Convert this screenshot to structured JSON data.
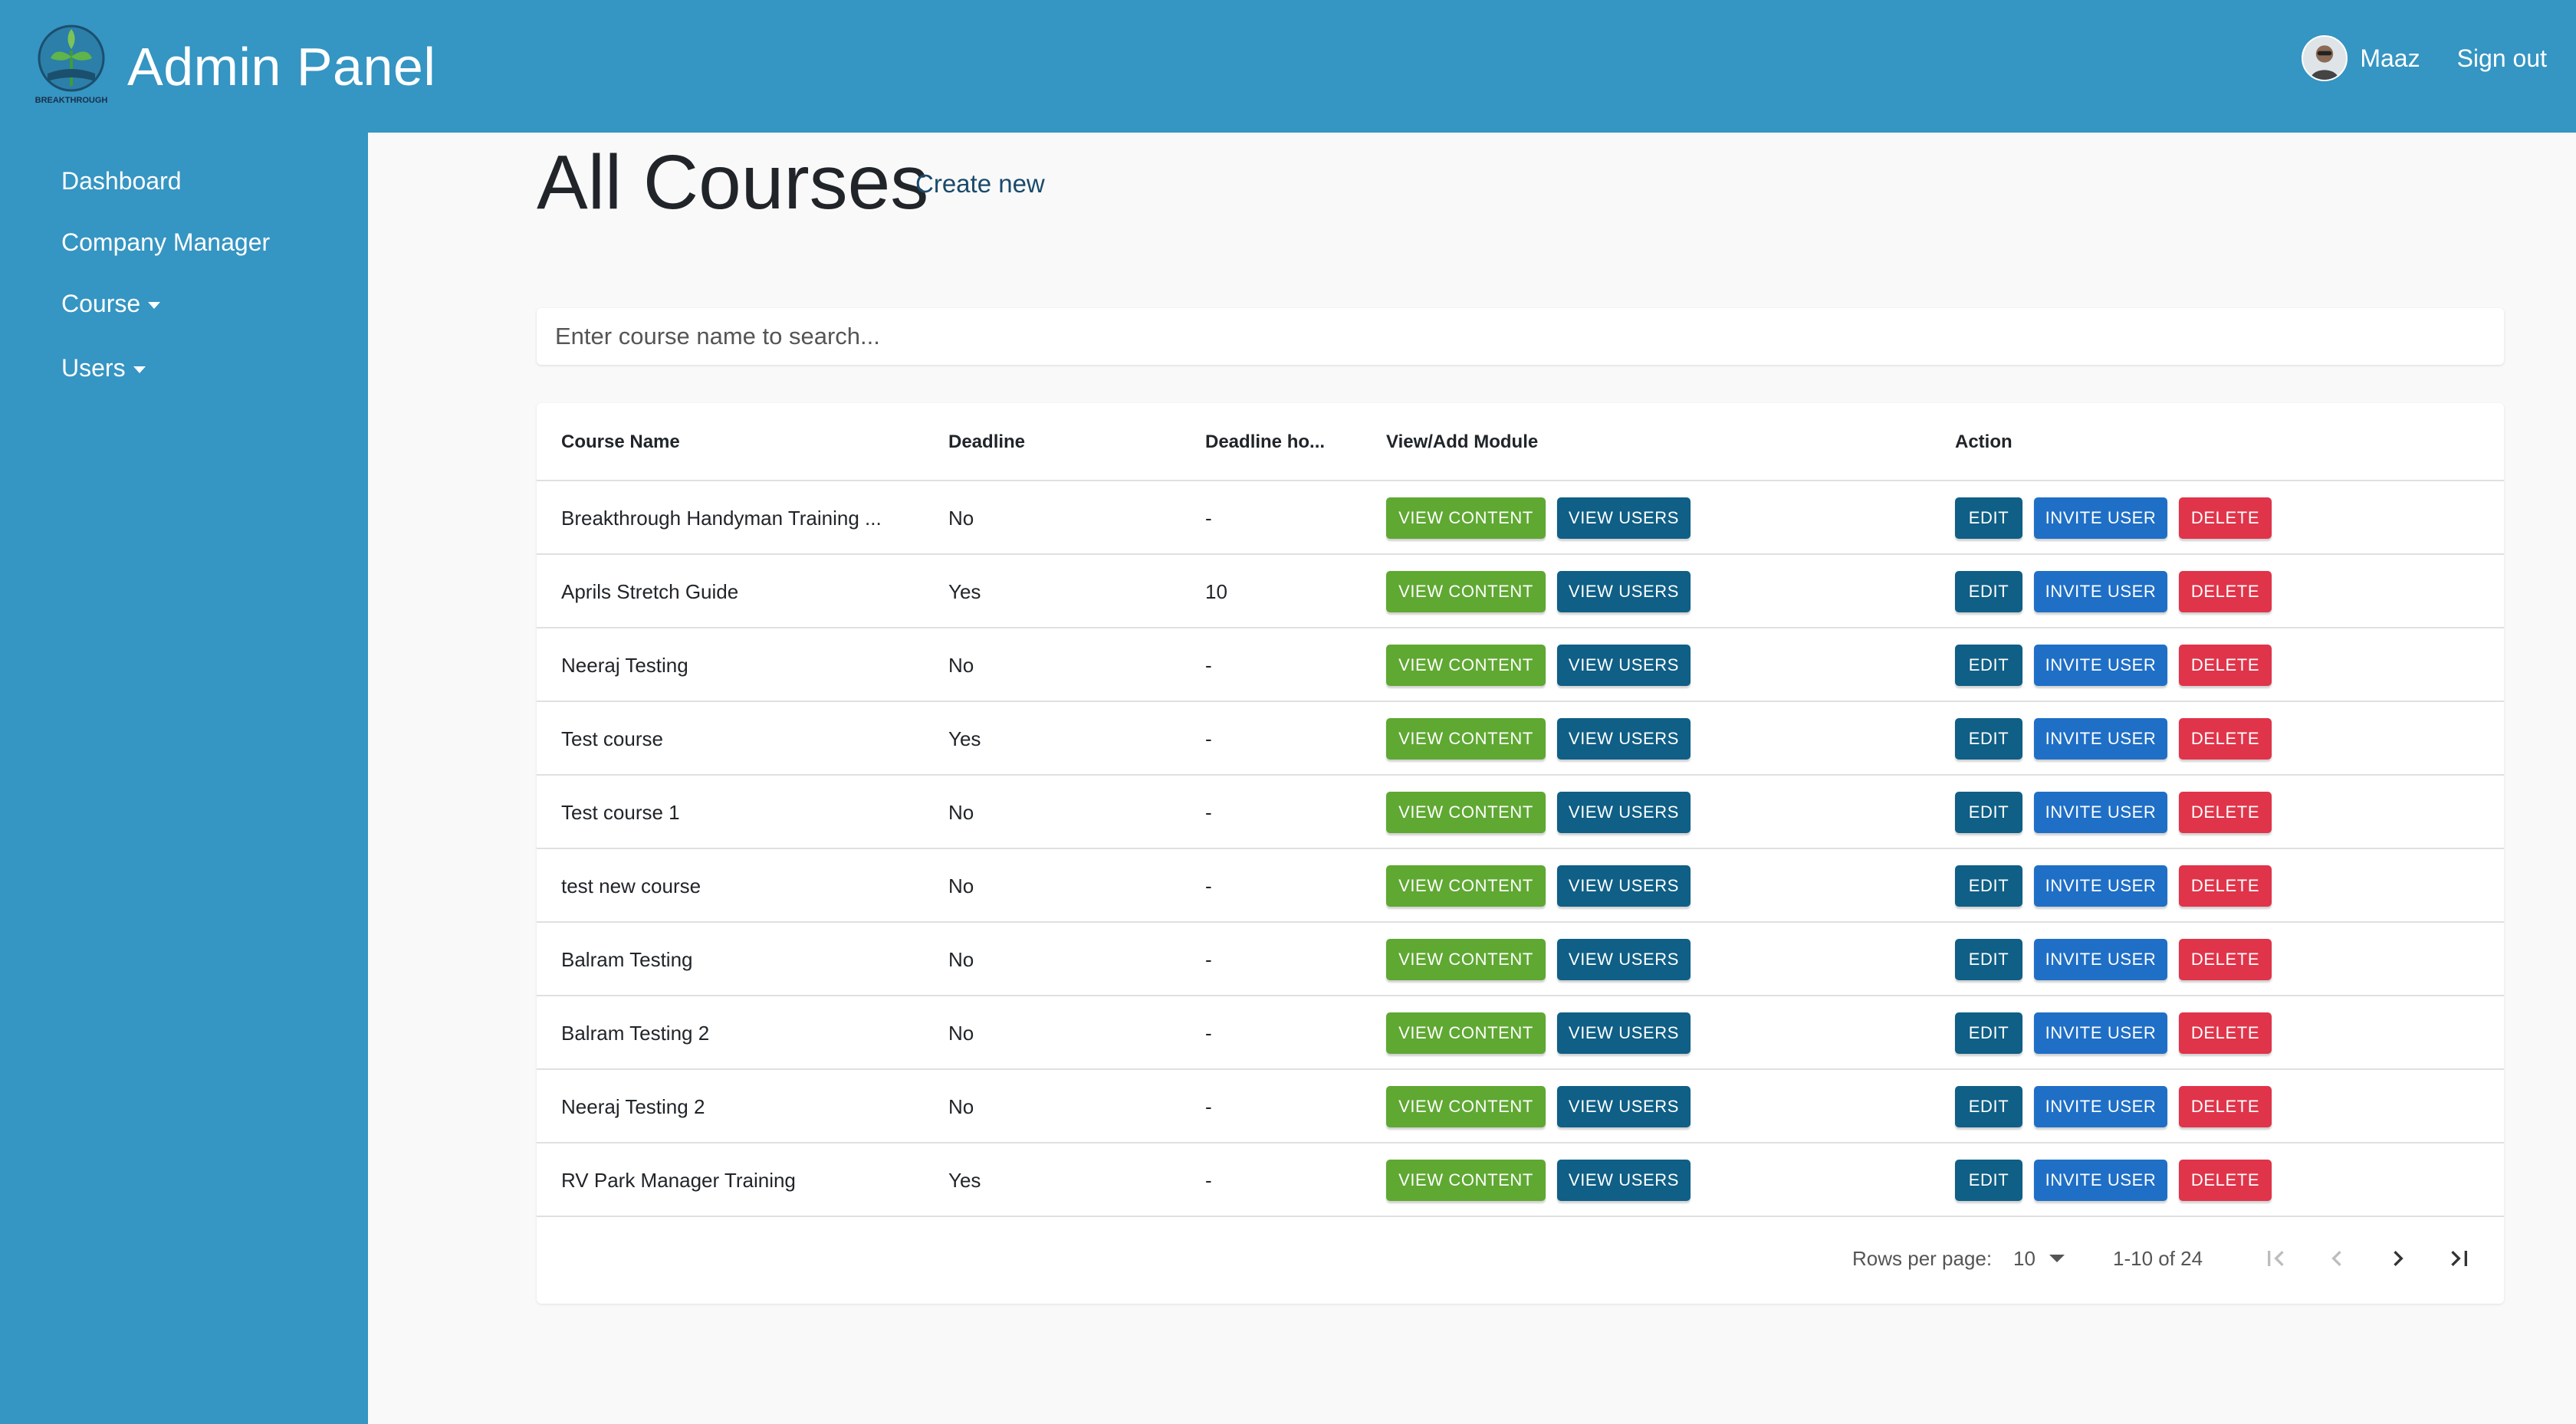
{
  "header": {
    "title": "Admin Panel",
    "logo_text": "BREAKTHROUGH",
    "user_name": "Maaz",
    "signout_label": "Sign out"
  },
  "sidebar": {
    "items": [
      {
        "label": "Dashboard",
        "has_caret": false
      },
      {
        "label": "Company Manager",
        "has_caret": false
      },
      {
        "label": "Course",
        "has_caret": true
      },
      {
        "label": "Users",
        "has_caret": true
      }
    ]
  },
  "page": {
    "title": "All Courses",
    "create_new_label": "Create new",
    "search_placeholder": "Enter course name to search..."
  },
  "table": {
    "columns": [
      "Course Name",
      "Deadline",
      "Deadline ho...",
      "View/Add Module",
      "Action"
    ],
    "button_labels": {
      "view_content": "VIEW CONTENT",
      "view_users": "VIEW USERS",
      "edit": "EDIT",
      "invite_user": "INVITE USER",
      "delete": "DELETE"
    },
    "rows": [
      {
        "name": "Breakthrough Handyman Training ...",
        "deadline": "No",
        "deadline_hours": "-"
      },
      {
        "name": "Aprils Stretch Guide",
        "deadline": "Yes",
        "deadline_hours": "10"
      },
      {
        "name": "Neeraj Testing",
        "deadline": "No",
        "deadline_hours": "-"
      },
      {
        "name": "Test course",
        "deadline": "Yes",
        "deadline_hours": "-"
      },
      {
        "name": "Test course 1",
        "deadline": "No",
        "deadline_hours": "-"
      },
      {
        "name": "test new course",
        "deadline": "No",
        "deadline_hours": "-"
      },
      {
        "name": "Balram Testing",
        "deadline": "No",
        "deadline_hours": "-"
      },
      {
        "name": "Balram Testing 2",
        "deadline": "No",
        "deadline_hours": "-"
      },
      {
        "name": "Neeraj Testing 2",
        "deadline": "No",
        "deadline_hours": "-"
      },
      {
        "name": "RV Park Manager Training",
        "deadline": "Yes",
        "deadline_hours": "-"
      }
    ]
  },
  "pagination": {
    "rows_per_page_label": "Rows per page:",
    "rows_per_page_value": "10",
    "range_text": "1-10 of 24"
  },
  "colors": {
    "header_bg": "#3595c3",
    "view_content": "#5fa832",
    "view_users": "#0f5f86",
    "edit": "#0f5f86",
    "invite_user": "#1f6fc6",
    "delete": "#e0344a"
  }
}
